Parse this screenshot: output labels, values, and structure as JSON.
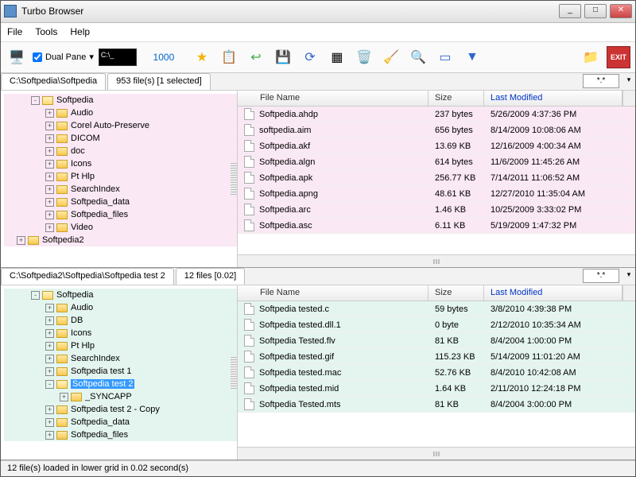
{
  "window": {
    "title": "Turbo Browser"
  },
  "menu": {
    "file": "File",
    "tools": "Tools",
    "help": "Help"
  },
  "toolbar": {
    "dualpane": "Dual Pane",
    "number": "1000",
    "exit": "EXIT"
  },
  "pane1": {
    "path": "C:\\Softpedia\\Softpedia",
    "info": "953 file(s) [1 selected]",
    "sort": "*.*",
    "tree": [
      {
        "d": 1,
        "exp": "-",
        "open": true,
        "label": "Softpedia"
      },
      {
        "d": 2,
        "exp": "+",
        "label": "Audio"
      },
      {
        "d": 2,
        "exp": "+",
        "label": "Corel Auto-Preserve"
      },
      {
        "d": 2,
        "exp": "+",
        "label": "DICOM"
      },
      {
        "d": 2,
        "exp": "+",
        "label": "doc"
      },
      {
        "d": 2,
        "exp": "+",
        "label": "Icons"
      },
      {
        "d": 2,
        "exp": "+",
        "label": "Pt Hlp"
      },
      {
        "d": 2,
        "exp": "+",
        "label": "SearchIndex"
      },
      {
        "d": 2,
        "exp": "+",
        "label": "Softpedia_data"
      },
      {
        "d": 2,
        "exp": "+",
        "label": "Softpedia_files"
      },
      {
        "d": 2,
        "exp": "+",
        "label": "Video"
      },
      {
        "d": 0,
        "exp": "+",
        "label": "Softpedia2"
      }
    ],
    "cols": {
      "name": "File Name",
      "size": "Size",
      "mod": "Last Modified"
    },
    "rows": [
      {
        "name": "Softpedia.ahdp",
        "size": "237 bytes",
        "mod": "5/26/2009 4:37:36 PM"
      },
      {
        "name": "softpedia.aim",
        "size": "656 bytes",
        "mod": "8/14/2009 10:08:06 AM"
      },
      {
        "name": "Softpedia.akf",
        "size": "13.69 KB",
        "mod": "12/16/2009 4:00:34 AM"
      },
      {
        "name": "Softpedia.algn",
        "size": "614 bytes",
        "mod": "11/6/2009 11:45:26 AM"
      },
      {
        "name": "Softpedia.apk",
        "size": "256.77 KB",
        "mod": "7/14/2011 11:06:52 AM"
      },
      {
        "name": "Softpedia.apng",
        "size": "48.61 KB",
        "mod": "12/27/2010 11:35:04 AM"
      },
      {
        "name": "Softpedia.arc",
        "size": "1.46 KB",
        "mod": "10/25/2009 3:33:02 PM"
      },
      {
        "name": "Softpedia.asc",
        "size": "6.11 KB",
        "mod": "5/19/2009 1:47:32 PM"
      }
    ]
  },
  "pane2": {
    "path": "C:\\Softpedia2\\Softpedia\\Softpedia test 2",
    "info": "12 files [0.02]",
    "sort": "*.*",
    "tree": [
      {
        "d": 1,
        "exp": "-",
        "open": true,
        "label": "Softpedia"
      },
      {
        "d": 2,
        "exp": "+",
        "label": "Audio"
      },
      {
        "d": 2,
        "exp": "+",
        "label": "DB"
      },
      {
        "d": 2,
        "exp": "+",
        "label": "Icons"
      },
      {
        "d": 2,
        "exp": "+",
        "label": "Pt Hlp"
      },
      {
        "d": 2,
        "exp": "+",
        "label": "SearchIndex"
      },
      {
        "d": 2,
        "exp": "+",
        "label": "Softpedia test 1"
      },
      {
        "d": 2,
        "exp": "-",
        "open": true,
        "sel": true,
        "label": "Softpedia test 2"
      },
      {
        "d": 3,
        "exp": "+",
        "label": "_SYNCAPP"
      },
      {
        "d": 2,
        "exp": "+",
        "label": "Softpedia test 2 - Copy"
      },
      {
        "d": 2,
        "exp": "+",
        "label": "Softpedia_data"
      },
      {
        "d": 2,
        "exp": "+",
        "label": "Softpedia_files"
      }
    ],
    "cols": {
      "name": "File Name",
      "size": "Size",
      "mod": "Last Modified"
    },
    "rows": [
      {
        "name": "Softpedia tested.c",
        "size": "59 bytes",
        "mod": "3/8/2010 4:39:38 PM"
      },
      {
        "name": "Softpedia tested.dll.1",
        "size": "0 byte",
        "mod": "2/12/2010 10:35:34 AM"
      },
      {
        "name": "Softpedia Tested.flv",
        "size": "81 KB",
        "mod": "8/4/2004 1:00:00 PM"
      },
      {
        "name": "Softpedia tested.gif",
        "size": "115.23 KB",
        "mod": "5/14/2009 11:01:20 AM"
      },
      {
        "name": "Softpedia tested.mac",
        "size": "52.76 KB",
        "mod": "8/4/2010 10:42:08 AM"
      },
      {
        "name": "Softpedia tested.mid",
        "size": "1.64 KB",
        "mod": "2/11/2010 12:24:18 PM"
      },
      {
        "name": "Softpedia Tested.mts",
        "size": "81 KB",
        "mod": "8/4/2004 3:00:00 PM"
      }
    ]
  },
  "status": "12 file(s) loaded in lower grid in 0.02 second(s)"
}
